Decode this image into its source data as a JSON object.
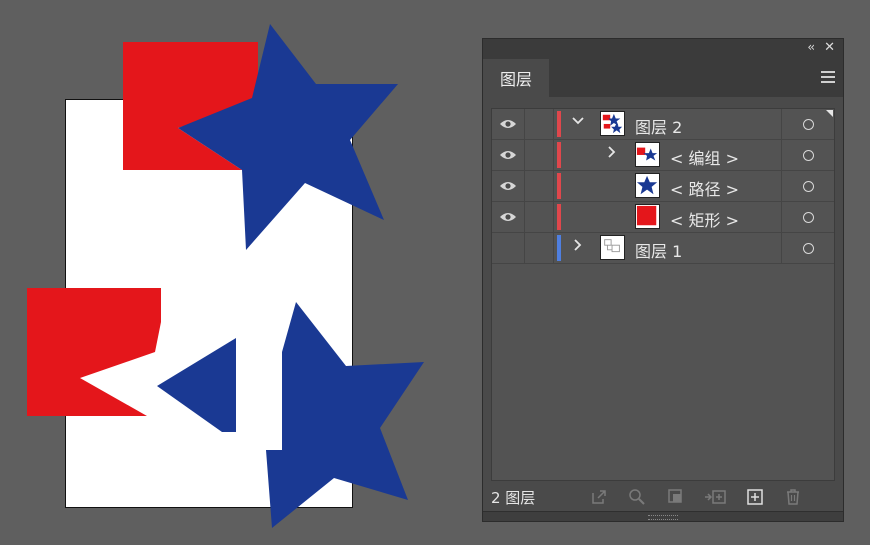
{
  "panel": {
    "tab_label": "图层",
    "collapse_symbol": "‹‹",
    "close_symbol": "✕",
    "layers": [
      {
        "label": "图层 2",
        "chevron": "⌄",
        "visible": true,
        "color": "#e0474c",
        "thumb": "layer2"
      },
      {
        "label": "< 编组 >",
        "chevron": "›",
        "visible": true,
        "color": "#e0474c",
        "thumb": "group"
      },
      {
        "label": "< 路径 >",
        "chevron": "",
        "visible": true,
        "color": "#e0474c",
        "thumb": "star"
      },
      {
        "label": "< 矩形 >",
        "chevron": "",
        "visible": true,
        "color": "#e0474c",
        "thumb": "rect"
      },
      {
        "label": "图层 1",
        "chevron": "›",
        "visible": false,
        "color": "#4f7fe0",
        "thumb": "layer1"
      }
    ],
    "footer": {
      "layer_count": "2 图层"
    }
  },
  "colors": {
    "red": "#e4161b",
    "blue": "#1a3993",
    "canvas_bg": "#5f5f5f",
    "panel_bg": "#4a4a4a"
  }
}
